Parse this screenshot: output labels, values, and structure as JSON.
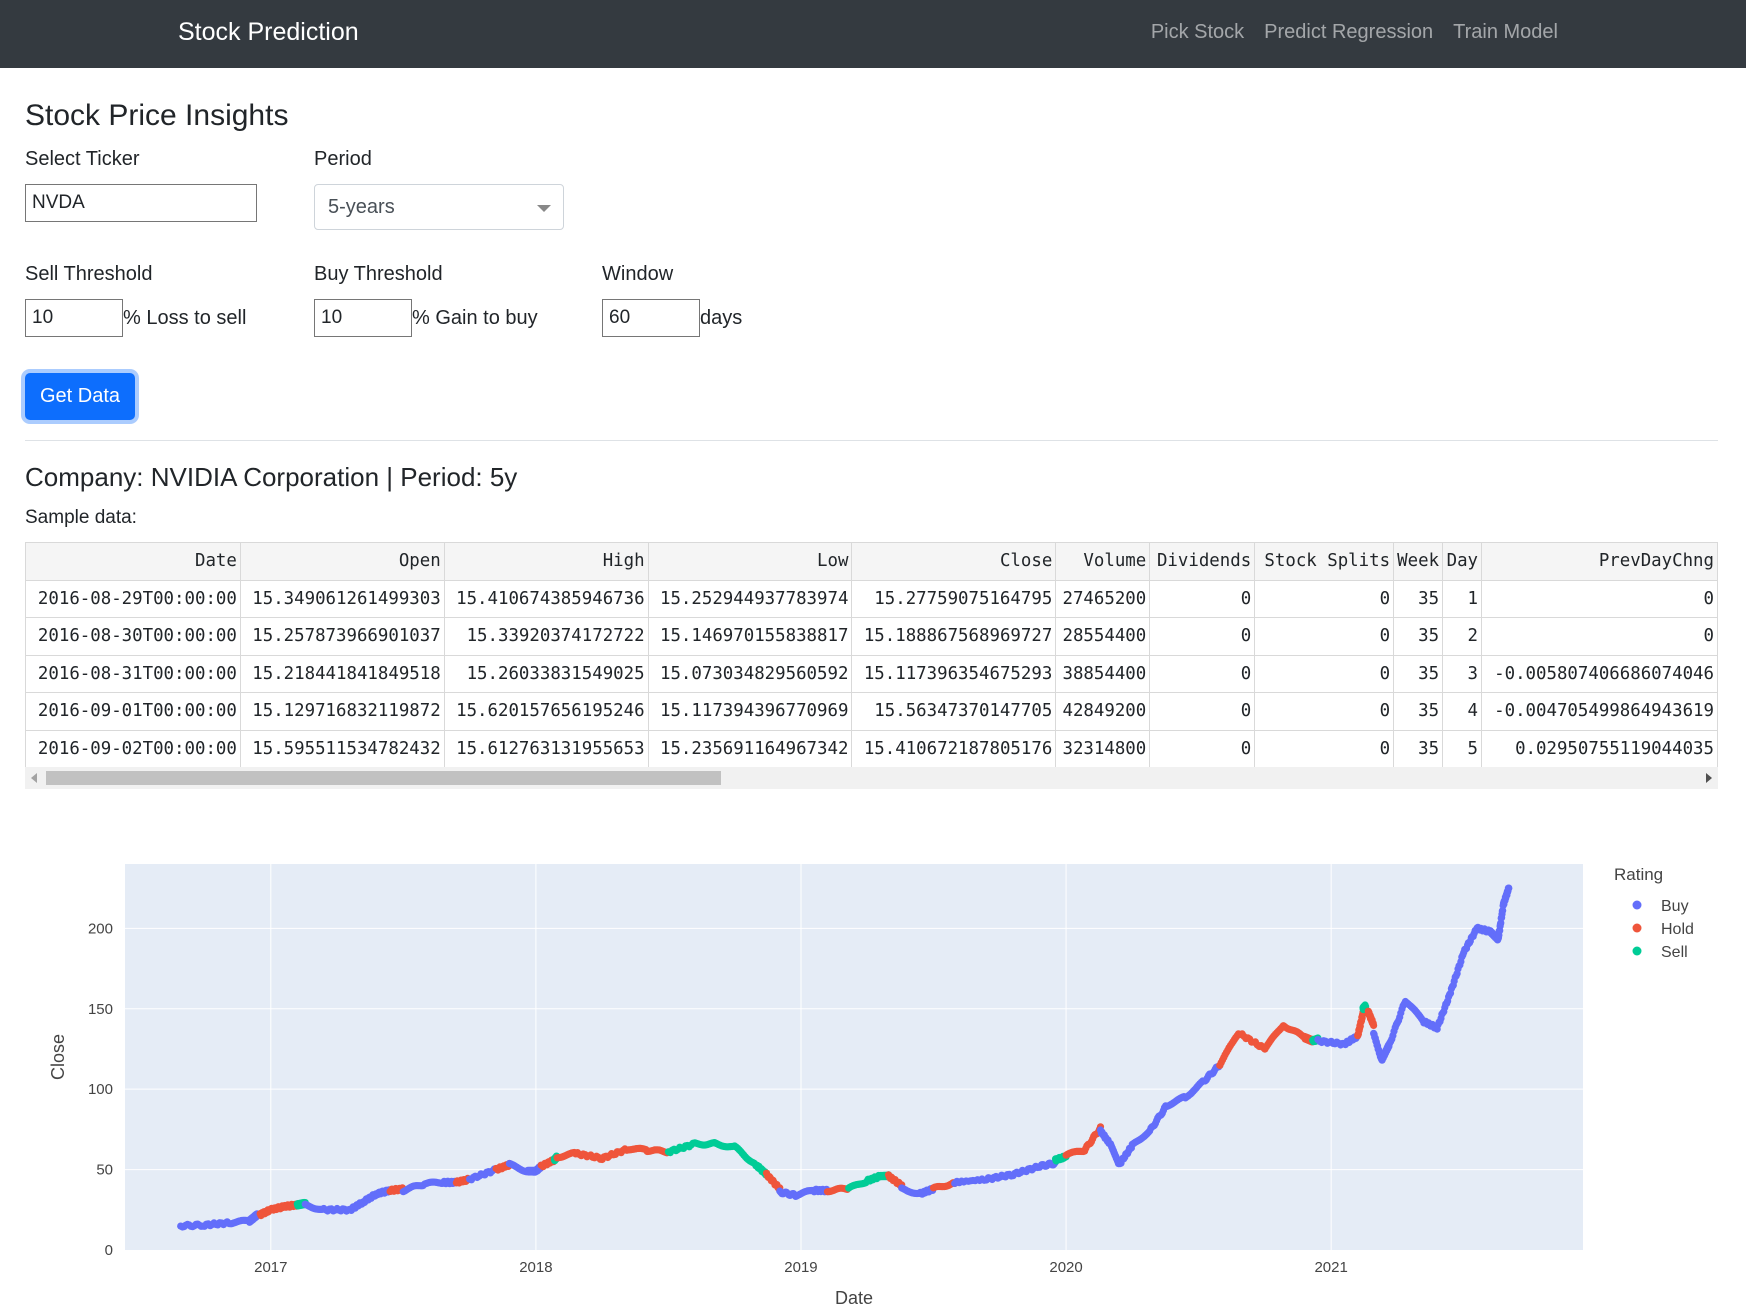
{
  "navbar": {
    "brand": "Stock Prediction",
    "links": [
      "Pick Stock",
      "Predict Regression",
      "Train Model"
    ]
  },
  "page": {
    "title": "Stock Price Insights",
    "ticker_label": "Select Ticker",
    "ticker_value": "NVDA",
    "period_label": "Period",
    "period_value": "5-years",
    "sell_label": "Sell Threshold",
    "sell_value": "10",
    "sell_suffix": "% Loss to sell",
    "buy_label": "Buy Threshold",
    "buy_value": "10",
    "buy_suffix": "% Gain to buy",
    "window_label": "Window",
    "window_value": "60",
    "window_suffix": "days",
    "button_label": "Get Data",
    "company": "Company: NVIDIA Corporation | Period: 5y",
    "sample_label": "Sample data:"
  },
  "table": {
    "columns": [
      "Date",
      "Open",
      "High",
      "Low",
      "Close",
      "Volume",
      "Dividends",
      "Stock Splits",
      "Week",
      "Day",
      "PrevDayChng"
    ],
    "rows": [
      [
        "2016-08-29T00:00:00",
        "15.349061261499303",
        "15.410674385946736",
        "15.252944937783974",
        "15.27759075164795",
        "27465200",
        "0",
        "0",
        "35",
        "1",
        "0"
      ],
      [
        "2016-08-30T00:00:00",
        "15.257873966901037",
        "15.33920374172722",
        "15.146970155838817",
        "15.188867568969727",
        "28554400",
        "0",
        "0",
        "35",
        "2",
        "0"
      ],
      [
        "2016-08-31T00:00:00",
        "15.218441841849518",
        "15.26033831549025",
        "15.073034829560592",
        "15.117396354675293",
        "38854400",
        "0",
        "0",
        "35",
        "3",
        "-0.005807406686074046"
      ],
      [
        "2016-09-01T00:00:00",
        "15.129716832119872",
        "15.620157656195246",
        "15.117394396770969",
        "15.56347370147705",
        "42849200",
        "0",
        "0",
        "35",
        "4",
        "-0.004705499864943619"
      ],
      [
        "2016-09-02T00:00:00",
        "15.595511534782432",
        "15.612763131955653",
        "15.235691164967342",
        "15.410672187805176",
        "32314800",
        "0",
        "0",
        "35",
        "5",
        "0.02950755119044035"
      ]
    ]
  },
  "chart_data": {
    "type": "scatter",
    "xlabel": "Date",
    "ylabel": "Close",
    "xlim": [
      2016.45,
      2021.95
    ],
    "ylim": [
      0,
      240
    ],
    "xticks": [
      "2017",
      "2018",
      "2019",
      "2020",
      "2021"
    ],
    "xtick_values": [
      2017,
      2018,
      2019,
      2020,
      2021
    ],
    "yticks": [
      0,
      50,
      100,
      150,
      200
    ],
    "grid": true,
    "legend_title": "Rating",
    "legend_placement": "top-right",
    "colors": {
      "Buy": "#636efa",
      "Hold": "#ef553b",
      "Sell": "#00cc96"
    },
    "segments": [
      {
        "rating": "Buy",
        "points": [
          [
            2016.66,
            15
          ],
          [
            2016.75,
            15.5
          ],
          [
            2016.85,
            17
          ],
          [
            2016.92,
            18
          ],
          [
            2016.95,
            22
          ]
        ]
      },
      {
        "rating": "Hold",
        "points": [
          [
            2016.96,
            22
          ],
          [
            2017.0,
            25
          ],
          [
            2017.05,
            27
          ],
          [
            2017.1,
            28
          ]
        ]
      },
      {
        "rating": "Sell",
        "points": [
          [
            2017.1,
            28
          ],
          [
            2017.13,
            29
          ]
        ]
      },
      {
        "rating": "Buy",
        "points": [
          [
            2017.13,
            28
          ],
          [
            2017.2,
            25
          ],
          [
            2017.3,
            25
          ],
          [
            2017.35,
            30
          ],
          [
            2017.4,
            35
          ],
          [
            2017.45,
            37
          ]
        ]
      },
      {
        "rating": "Hold",
        "points": [
          [
            2017.45,
            37
          ],
          [
            2017.5,
            38
          ]
        ]
      },
      {
        "rating": "Buy",
        "points": [
          [
            2017.5,
            37
          ],
          [
            2017.58,
            41
          ],
          [
            2017.65,
            42
          ],
          [
            2017.7,
            42
          ]
        ]
      },
      {
        "rating": "Hold",
        "points": [
          [
            2017.7,
            42
          ],
          [
            2017.75,
            44
          ]
        ]
      },
      {
        "rating": "Buy",
        "points": [
          [
            2017.75,
            44
          ],
          [
            2017.85,
            50
          ]
        ]
      },
      {
        "rating": "Hold",
        "points": [
          [
            2017.85,
            50
          ],
          [
            2017.9,
            53
          ]
        ]
      },
      {
        "rating": "Buy",
        "points": [
          [
            2017.9,
            53
          ],
          [
            2017.97,
            49
          ],
          [
            2018.0,
            49
          ],
          [
            2018.02,
            52
          ]
        ]
      },
      {
        "rating": "Hold",
        "points": [
          [
            2018.02,
            52
          ],
          [
            2018.07,
            56
          ]
        ]
      },
      {
        "rating": "Sell",
        "points": [
          [
            2018.07,
            56
          ],
          [
            2018.08,
            58
          ]
        ]
      },
      {
        "rating": "Hold",
        "points": [
          [
            2018.08,
            58
          ],
          [
            2018.15,
            60
          ],
          [
            2018.25,
            57
          ],
          [
            2018.35,
            63
          ],
          [
            2018.42,
            62
          ],
          [
            2018.5,
            61
          ]
        ]
      },
      {
        "rating": "Sell",
        "points": [
          [
            2018.5,
            61
          ],
          [
            2018.6,
            66
          ],
          [
            2018.68,
            66
          ],
          [
            2018.75,
            64
          ],
          [
            2018.83,
            53
          ],
          [
            2018.87,
            47
          ]
        ]
      },
      {
        "rating": "Hold",
        "points": [
          [
            2018.87,
            47
          ],
          [
            2018.92,
            38
          ]
        ]
      },
      {
        "rating": "Buy",
        "points": [
          [
            2018.92,
            36
          ],
          [
            2018.98,
            34
          ],
          [
            2019.05,
            37
          ],
          [
            2019.1,
            37
          ]
        ]
      },
      {
        "rating": "Hold",
        "points": [
          [
            2019.1,
            37
          ],
          [
            2019.18,
            38
          ]
        ]
      },
      {
        "rating": "Sell",
        "points": [
          [
            2019.18,
            38
          ],
          [
            2019.25,
            43
          ],
          [
            2019.3,
            46
          ],
          [
            2019.33,
            46
          ]
        ]
      },
      {
        "rating": "Hold",
        "points": [
          [
            2019.33,
            46
          ],
          [
            2019.38,
            40
          ]
        ]
      },
      {
        "rating": "Buy",
        "points": [
          [
            2019.38,
            38
          ],
          [
            2019.45,
            35
          ],
          [
            2019.5,
            38
          ]
        ]
      },
      {
        "rating": "Hold",
        "points": [
          [
            2019.5,
            38
          ],
          [
            2019.58,
            42
          ]
        ]
      },
      {
        "rating": "Buy",
        "points": [
          [
            2019.58,
            42
          ],
          [
            2019.7,
            44
          ],
          [
            2019.8,
            47
          ],
          [
            2019.9,
            52
          ],
          [
            2019.96,
            54
          ]
        ]
      },
      {
        "rating": "Sell",
        "points": [
          [
            2019.96,
            56
          ],
          [
            2020.0,
            58
          ]
        ]
      },
      {
        "rating": "Hold",
        "points": [
          [
            2020.0,
            59
          ],
          [
            2020.07,
            62
          ],
          [
            2020.13,
            76
          ]
        ]
      },
      {
        "rating": "Buy",
        "points": [
          [
            2020.13,
            74
          ],
          [
            2020.17,
            65
          ],
          [
            2020.2,
            53
          ],
          [
            2020.25,
            65
          ],
          [
            2020.32,
            75
          ],
          [
            2020.38,
            90
          ],
          [
            2020.45,
            95
          ],
          [
            2020.52,
            105
          ],
          [
            2020.58,
            115
          ]
        ]
      },
      {
        "rating": "Hold",
        "points": [
          [
            2020.58,
            115
          ],
          [
            2020.65,
            135
          ],
          [
            2020.75,
            125
          ],
          [
            2020.82,
            140
          ],
          [
            2020.9,
            132
          ],
          [
            2020.93,
            130
          ]
        ]
      },
      {
        "rating": "Sell",
        "points": [
          [
            2020.93,
            130
          ],
          [
            2020.95,
            131
          ]
        ]
      },
      {
        "rating": "Buy",
        "points": [
          [
            2020.95,
            130
          ],
          [
            2021.05,
            128
          ],
          [
            2021.1,
            133
          ]
        ]
      },
      {
        "rating": "Hold",
        "points": [
          [
            2021.1,
            133
          ],
          [
            2021.12,
            147
          ]
        ]
      },
      {
        "rating": "Sell",
        "points": [
          [
            2021.12,
            150
          ],
          [
            2021.13,
            152
          ]
        ]
      },
      {
        "rating": "Hold",
        "points": [
          [
            2021.14,
            148
          ],
          [
            2021.16,
            140
          ]
        ]
      },
      {
        "rating": "Buy",
        "points": [
          [
            2021.16,
            135
          ],
          [
            2021.19,
            118
          ],
          [
            2021.22,
            128
          ],
          [
            2021.28,
            155
          ],
          [
            2021.35,
            142
          ],
          [
            2021.4,
            138
          ],
          [
            2021.45,
            160
          ],
          [
            2021.5,
            185
          ],
          [
            2021.55,
            200
          ],
          [
            2021.6,
            198
          ],
          [
            2021.63,
            193
          ],
          [
            2021.65,
            215
          ],
          [
            2021.67,
            225
          ]
        ]
      }
    ]
  }
}
